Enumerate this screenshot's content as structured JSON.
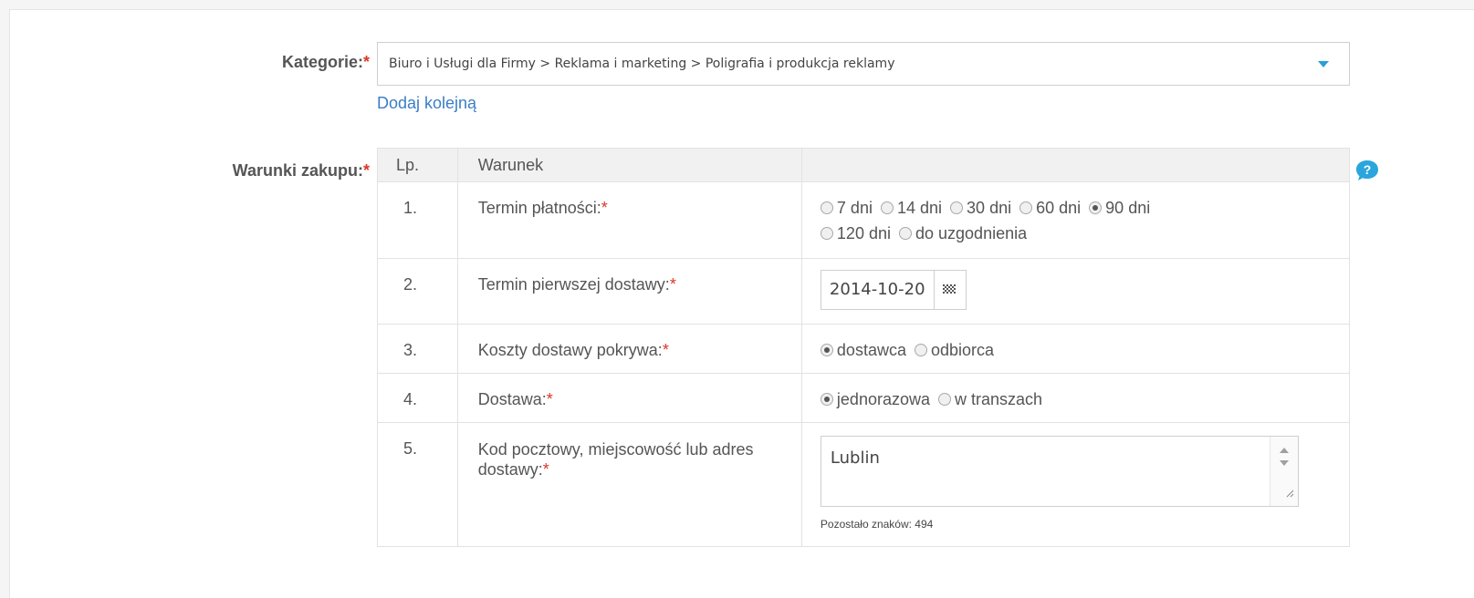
{
  "form": {
    "categories_label": "Kategorie:",
    "required_mark": "*",
    "categories_value": "Biuro i Usługi dla Firmy > Reklama i marketing > Poligrafia i produkcja reklamy",
    "add_another_link": "Dodaj kolejną",
    "purchase_terms_label": "Warunki zakupu:"
  },
  "table": {
    "headers": [
      "Lp.",
      "Warunek",
      ""
    ],
    "rows": [
      {
        "num": "1.",
        "condition": "Termin płatności:",
        "options": [
          {
            "label": "7 dni",
            "checked": false
          },
          {
            "label": "14 dni",
            "checked": false
          },
          {
            "label": "30 dni",
            "checked": false
          },
          {
            "label": "60 dni",
            "checked": false
          },
          {
            "label": "90 dni",
            "checked": true
          },
          {
            "label": "120 dni",
            "checked": false
          },
          {
            "label": "do uzgodnienia",
            "checked": false
          }
        ]
      },
      {
        "num": "2.",
        "condition": "Termin pierwszej dostawy:",
        "date_value": "2014-10-20"
      },
      {
        "num": "3.",
        "condition": "Koszty dostawy pokrywa:",
        "options": [
          {
            "label": "dostawca",
            "checked": true
          },
          {
            "label": "odbiorca",
            "checked": false
          }
        ]
      },
      {
        "num": "4.",
        "condition": "Dostawa:",
        "options": [
          {
            "label": "jednorazowa",
            "checked": true
          },
          {
            "label": "w transzach",
            "checked": false
          }
        ]
      },
      {
        "num": "5.",
        "condition": "Kod pocztowy, miejscowość lub adres dostawy:",
        "textarea_value": "Lublin",
        "remaining_chars": "Pozostało znaków: 494"
      }
    ]
  },
  "colors": {
    "link": "#3b7ec6",
    "required": "#d9382a",
    "accent": "#2a9fd8"
  },
  "icons": {
    "dropdown": "chevron-down-icon",
    "calendar": "calendar-icon",
    "help": "help-icon"
  }
}
